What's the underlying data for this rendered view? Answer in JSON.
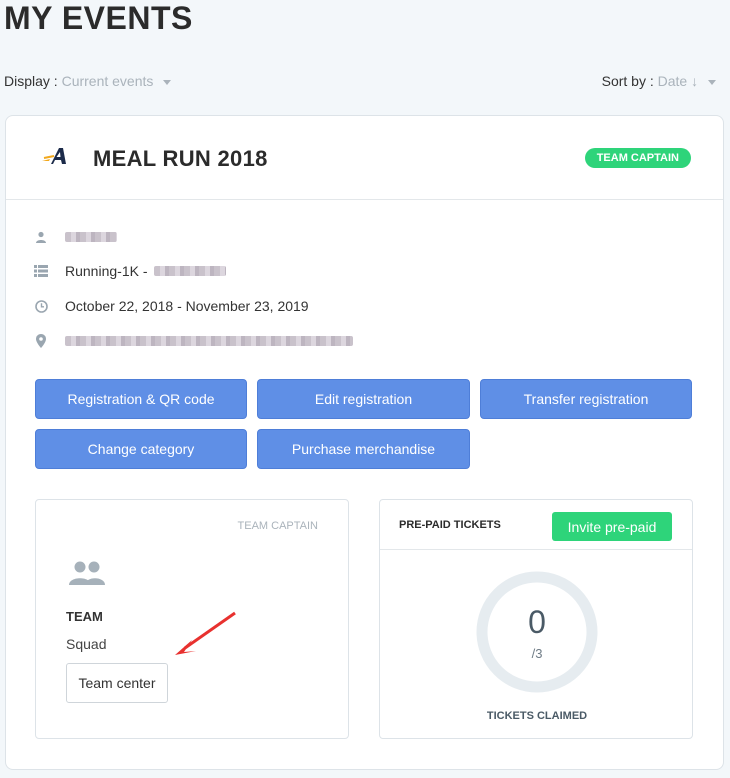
{
  "page": {
    "title": "MY EVENTS"
  },
  "filters": {
    "display_label": "Display :",
    "display_value": "Current events",
    "sort_label": "Sort by :",
    "sort_value": "Date ↓"
  },
  "event": {
    "title": "MEAL RUN 2018",
    "role_badge": "TEAM CAPTAIN",
    "category_prefix": "Running-1K -",
    "dates": "October 22, 2018 - November 23, 2019",
    "colors": {
      "accent": "#5f8fe6",
      "badge": "#2ed47a"
    }
  },
  "actions": {
    "registration_qr": "Registration & QR code",
    "edit_registration": "Edit registration",
    "transfer_registration": "Transfer registration",
    "change_category": "Change category",
    "purchase_merchandise": "Purchase merchandise"
  },
  "team_panel": {
    "role": "TEAM CAPTAIN",
    "label": "TEAM",
    "team_name": "Squad",
    "team_center_button": "Team center",
    "icon": "users-icon"
  },
  "prepaid": {
    "title": "PRE-PAID TICKETS",
    "invite_button": "Invite pre-paid",
    "claimed": "0",
    "total": "/3",
    "claimed_label": "TICKETS CLAIMED"
  }
}
